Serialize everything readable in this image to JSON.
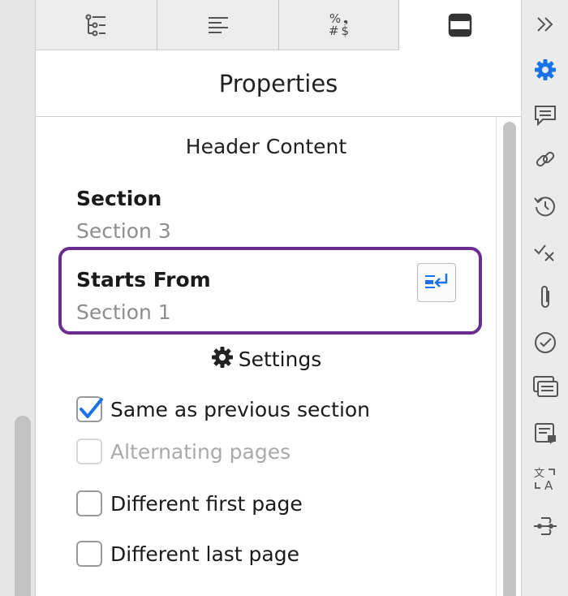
{
  "tabs": [
    {
      "name": "list-tree-icon",
      "active": false
    },
    {
      "name": "paragraph-align-icon",
      "active": false
    },
    {
      "name": "number-format-icon",
      "active": false,
      "glyph_top": "% ❟",
      "glyph_bottom": "# $"
    },
    {
      "name": "header-footer-icon",
      "active": true
    }
  ],
  "panel": {
    "title": "Properties",
    "header_content": "Header Content",
    "section_label": "Section",
    "section_value": "Section 3",
    "starts_from_label": "Starts From",
    "starts_from_value": "Section 1",
    "settings_label": "Settings",
    "options": [
      {
        "label": "Same as previous section",
        "checked": true,
        "disabled": false
      },
      {
        "label": "Alternating pages",
        "checked": false,
        "disabled": true
      },
      {
        "label": "Different first page",
        "checked": false,
        "disabled": false
      },
      {
        "label": "Different last page",
        "checked": false,
        "disabled": false
      }
    ]
  },
  "colors": {
    "accent": "#1a73e8",
    "highlight": "#6a2c91",
    "icon": "#555555"
  },
  "rightbar": [
    "collapse-chevrons-icon",
    "settings-gear-icon",
    "comments-icon",
    "link-icon",
    "history-icon",
    "track-changes-icon",
    "attachment-icon",
    "approval-icon",
    "review-list-icon",
    "notes-icon",
    "translate-icon",
    "merge-icon"
  ]
}
